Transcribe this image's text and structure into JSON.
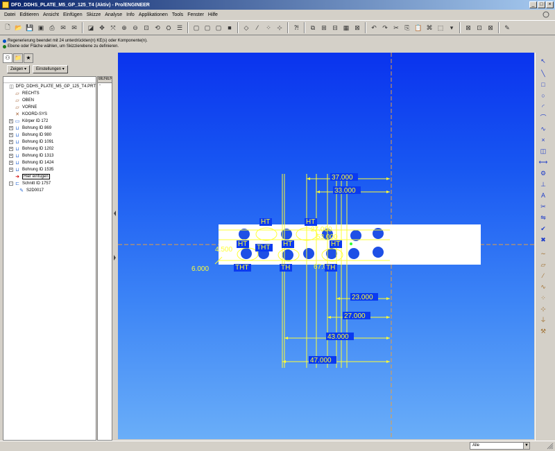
{
  "window": {
    "title": "DFD_DDHS_PLATE_M5_GP_125_T4 (Aktiv) - Pro/ENGINEER",
    "minimize": "_",
    "maximize": "□",
    "close": "×"
  },
  "menu": [
    "Datei",
    "Editieren",
    "Ansicht",
    "Einfügen",
    "Skizze",
    "Analyse",
    "Info",
    "Applikationen",
    "Tools",
    "Fenster",
    "Hilfe"
  ],
  "messages": [
    "Regenerierung beendet mit 24 unterdrückten(n) KE(s) oder Komponente(n).",
    "Ebene oder Fläche wählen, um Skizzierebene zu definieren."
  ],
  "left_panel": {
    "show_button": "Zeigen",
    "settings_button": "Einstellungen",
    "column_header": "BENEN",
    "column_value": "-",
    "tree": [
      {
        "label": "DFD_DDHS_PLATE_M5_GP_125_T4.PRT",
        "icon": "part-icon",
        "indent": 0,
        "expander": ""
      },
      {
        "label": "RECHTS",
        "icon": "datum-plane-icon",
        "indent": 1,
        "expander": ""
      },
      {
        "label": "OBEN",
        "icon": "datum-plane-icon",
        "indent": 1,
        "expander": ""
      },
      {
        "label": "VORNE",
        "icon": "datum-plane-icon",
        "indent": 1,
        "expander": ""
      },
      {
        "label": "KOORD-SYS",
        "icon": "coordinate-system-icon",
        "indent": 1,
        "expander": ""
      },
      {
        "label": "Körper ID 172",
        "icon": "extrude-icon",
        "indent": 1,
        "expander": "+"
      },
      {
        "label": "Bohrung ID 869",
        "icon": "hole-icon",
        "indent": 1,
        "expander": "+"
      },
      {
        "label": "Bohrung ID 980",
        "icon": "hole-icon",
        "indent": 1,
        "expander": "+"
      },
      {
        "label": "Bohrung ID 1091",
        "icon": "hole-icon",
        "indent": 1,
        "expander": "+"
      },
      {
        "label": "Bohrung ID 1202",
        "icon": "hole-icon",
        "indent": 1,
        "expander": "+"
      },
      {
        "label": "Bohrung ID 1313",
        "icon": "hole-icon",
        "indent": 1,
        "expander": "+"
      },
      {
        "label": "Bohrung ID 1424",
        "icon": "hole-icon",
        "indent": 1,
        "expander": "+"
      },
      {
        "label": "Bohrung ID 1535",
        "icon": "hole-icon",
        "indent": 1,
        "expander": "+"
      },
      {
        "label": "Hier einfügen",
        "icon": "insert-arrow-icon",
        "indent": 1,
        "expander": "",
        "highlight": true
      },
      {
        "label": "Schnitt ID 1757",
        "icon": "cut-icon",
        "indent": 1,
        "expander": "-"
      },
      {
        "label": "S2D0017",
        "icon": "sketch-icon",
        "indent": 2,
        "expander": ""
      }
    ]
  },
  "sketch": {
    "dimensions": [
      "37.000",
      "33.000",
      "27.000",
      "53.000",
      "4.500",
      "6.000",
      "67.000",
      "23.000",
      "27.000",
      "43.000",
      "47.000"
    ],
    "hole_labels": [
      "HT",
      "HT",
      "HT",
      "HT",
      "HT",
      "THT",
      "THT",
      "TH",
      "TH"
    ],
    "colors": {
      "background_top": "#0a33ee",
      "background_bottom": "#6aaef8",
      "dimension": "#ffff33",
      "datum": "#e8a040",
      "plate": "#ffffff",
      "hole": "#1e50e6"
    }
  },
  "status": {
    "filter_value": "Alle"
  }
}
